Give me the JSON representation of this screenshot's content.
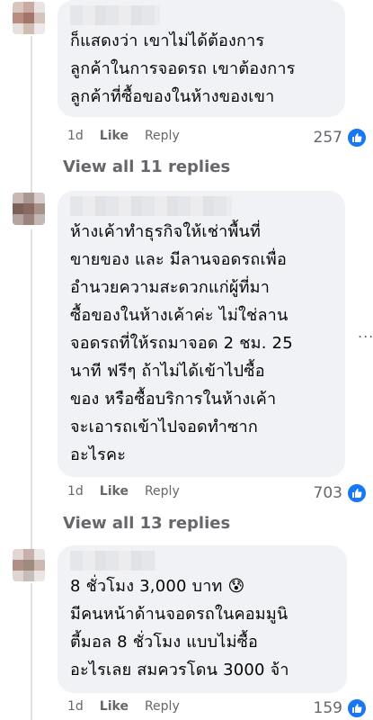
{
  "comments": [
    {
      "text": "ก็แสดงว่า เขาไม่ได้ต้องการ\nลูกค้าในการจอดรถ เขาต้องการ\nลูกค้าที่ซื้อของในห้างของเขา",
      "time": "1d",
      "like_label": "Like",
      "reply_label": "Reply",
      "reaction_count": "257"
    },
    {
      "text": "ห้างเค้าทำธุรกิจให้เช่าพื้นที่\nขายของ และ มีลานจอดรถเพื่อ\nอำนวยความสะดวกแก่ผู้ที่มา\nซื้อของในห้างเค้าค่ะ ไม่ใช่ลาน\nจอดรถที่ให้รถมาจอด 2 ชม. 25\nนาที ฟรีๆ ถ้าไม่ได้เข้าไปซื้อ\nของ หรือซื้อบริการในห้างเค้า\nจะเอารถเข้าไปจอดทำซาก\nอะไรคะ",
      "time": "1d",
      "like_label": "Like",
      "reply_label": "Reply",
      "reaction_count": "703"
    },
    {
      "text": "8 ชั่วโมง 3,000 บาท 😰\nมีคนหน้าด้านจอดรถในคอมมูนิ\nตี้มอล 8 ชั่วโมง แบบไม่ซื้อ\nอะไรเลย สมควรโดน 3000 จ้า",
      "time": "1d",
      "like_label": "Like",
      "reply_label": "Reply",
      "reaction_count": "159"
    }
  ],
  "view_replies": [
    "View all 11 replies",
    "View all 13 replies"
  ],
  "more_options": "...",
  "colors": {
    "bubble": "#f0f2f5",
    "meta_text": "#65676b",
    "reaction_blue": "#1877f2"
  },
  "icons": {
    "reaction": "thumbs-up-icon",
    "more": "more-options-icon"
  }
}
